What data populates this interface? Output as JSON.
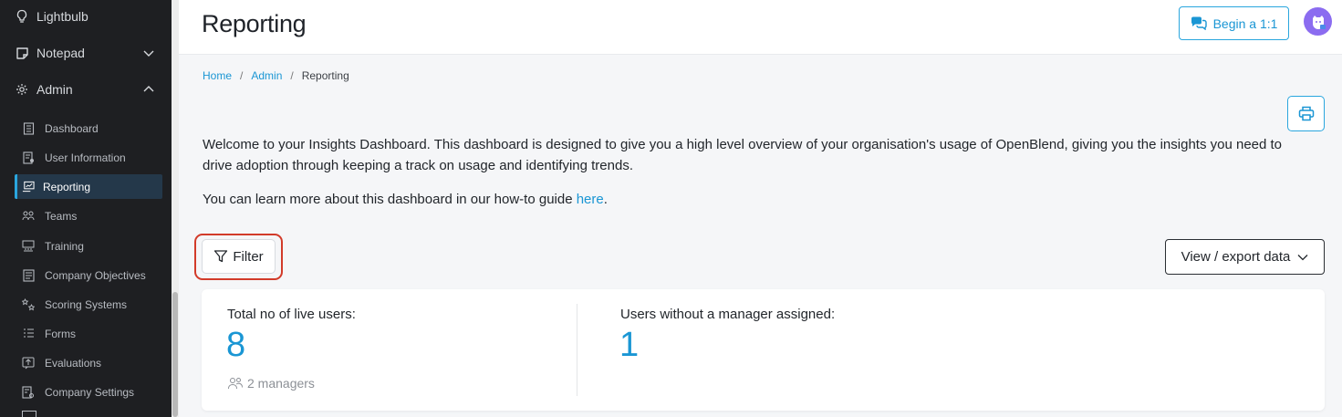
{
  "sidebar": {
    "top_items": [
      {
        "label": "Lightbulb",
        "icon": "lightbulb-icon"
      },
      {
        "label": "Notepad",
        "icon": "notepad-icon",
        "expanded": false
      },
      {
        "label": "Admin",
        "icon": "gear-icon",
        "expanded": true
      }
    ],
    "admin_items": [
      {
        "label": "Dashboard",
        "icon": "dashboard-icon"
      },
      {
        "label": "User Information",
        "icon": "user-info-icon"
      },
      {
        "label": "Reporting",
        "icon": "reporting-icon",
        "active": true
      },
      {
        "label": "Teams",
        "icon": "teams-icon"
      },
      {
        "label": "Training",
        "icon": "training-icon"
      },
      {
        "label": "Company Objectives",
        "icon": "objectives-icon"
      },
      {
        "label": "Scoring Systems",
        "icon": "scoring-icon"
      },
      {
        "label": "Forms",
        "icon": "forms-icon"
      },
      {
        "label": "Evaluations",
        "icon": "evaluations-icon"
      },
      {
        "label": "Company Settings",
        "icon": "company-settings-icon"
      }
    ]
  },
  "header": {
    "title": "Reporting",
    "begin_label": "Begin a 1:1"
  },
  "breadcrumb": {
    "home": "Home",
    "admin": "Admin",
    "current": "Reporting",
    "separator": "/"
  },
  "intro": {
    "paragraph": "Welcome to your Insights Dashboard. This dashboard is designed to give you a high level overview of your organisation's usage of OpenBlend, giving you the insights you need to drive adoption through keeping a track on usage and identifying trends.",
    "learn_prefix": "You can learn more about this dashboard in our how-to guide ",
    "learn_link": "here",
    "learn_suffix": "."
  },
  "toolbar": {
    "filter_label": "Filter",
    "export_label": "View / export data"
  },
  "stats": {
    "live_users_label": "Total no of live users:",
    "live_users_value": "8",
    "managers_text": "2 managers",
    "no_manager_label": "Users without a manager assigned:",
    "no_manager_value": "1"
  },
  "colors": {
    "accent": "#1a96d4",
    "sidebar_bg": "#1e1f22",
    "active_item_bg": "#24384a",
    "highlight": "#d23b2a",
    "avatar_bg": "#8b6cf0"
  }
}
